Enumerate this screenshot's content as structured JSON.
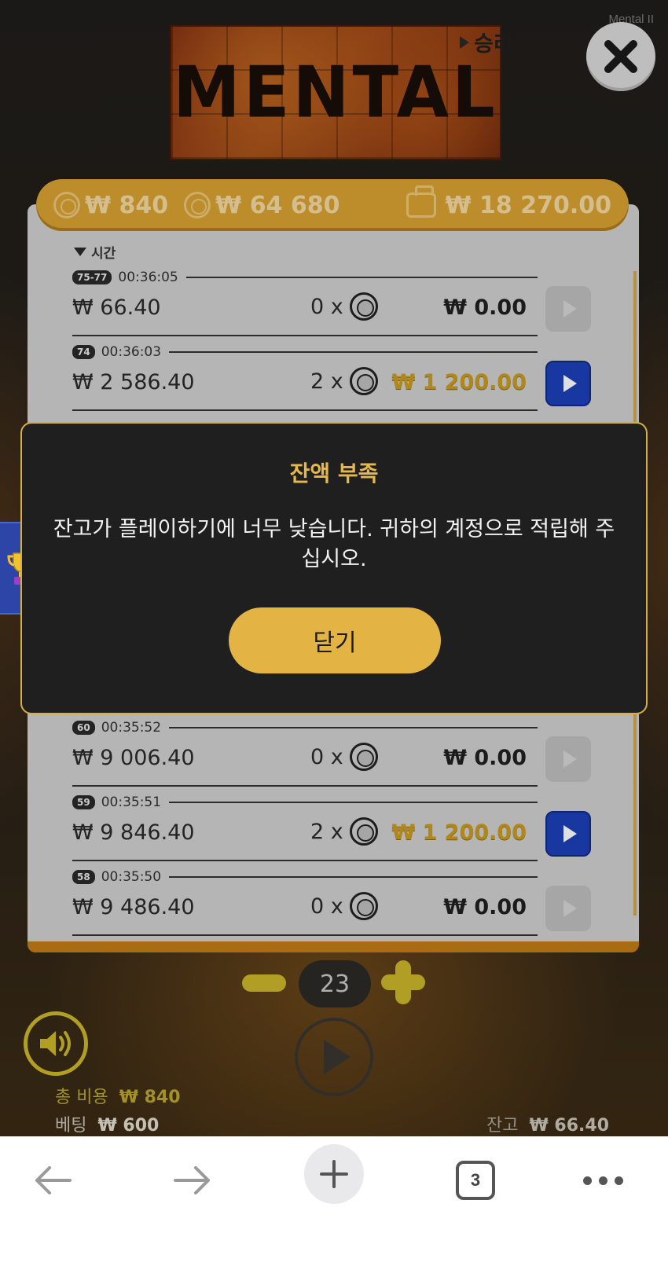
{
  "game": {
    "watermark": "Mental II",
    "logo_text": "MENTAL"
  },
  "balance_bar": {
    "bet_cost": "₩ 840",
    "total_value": "₩ 64 680",
    "wallet": "₩ 18 270.00"
  },
  "history": {
    "col_time": "시간",
    "col_win": "승리",
    "rows": [
      {
        "badge": "75-77",
        "time": "00:36:05",
        "amount": "₩ 66.40",
        "mult": "0 x",
        "win": "₩ 0.00",
        "win_style": "plain",
        "replay_active": false
      },
      {
        "badge": "74",
        "time": "00:36:03",
        "amount": "₩ 2 586.40",
        "mult": "2 x",
        "win": "₩ 1 200.00",
        "win_style": "gold",
        "replay_active": true
      },
      {
        "badge": "60",
        "time": "00:35:52",
        "amount": "₩ 9 006.40",
        "mult": "0 x",
        "win": "₩ 0.00",
        "win_style": "plain",
        "replay_active": false
      },
      {
        "badge": "59",
        "time": "00:35:51",
        "amount": "₩ 9 846.40",
        "mult": "2 x",
        "win": "₩ 1 200.00",
        "win_style": "gold",
        "replay_active": true
      },
      {
        "badge": "58",
        "time": "00:35:50",
        "amount": "₩ 9 486.40",
        "mult": "0 x",
        "win": "₩ 0.00",
        "win_style": "plain",
        "replay_active": false
      }
    ]
  },
  "modal": {
    "title": "잔액 부족",
    "message": "잔고가 플레이하기에 너무 낮습니다. 귀하의 계정으로 적립해 주십시오.",
    "close_label": "닫기"
  },
  "controls": {
    "bet_level": "23",
    "total_cost_label": "총 비용",
    "total_cost_value": "₩ 840",
    "bet_label": "베팅",
    "bet_value": "₩ 600",
    "balance_label": "잔고",
    "balance_value": "₩ 66.40"
  },
  "browser": {
    "tab_count": "3"
  },
  "colors": {
    "accent_gold": "#e3b443",
    "replay_blue": "#1d3fb8",
    "win_gold": "#c99a1f"
  }
}
